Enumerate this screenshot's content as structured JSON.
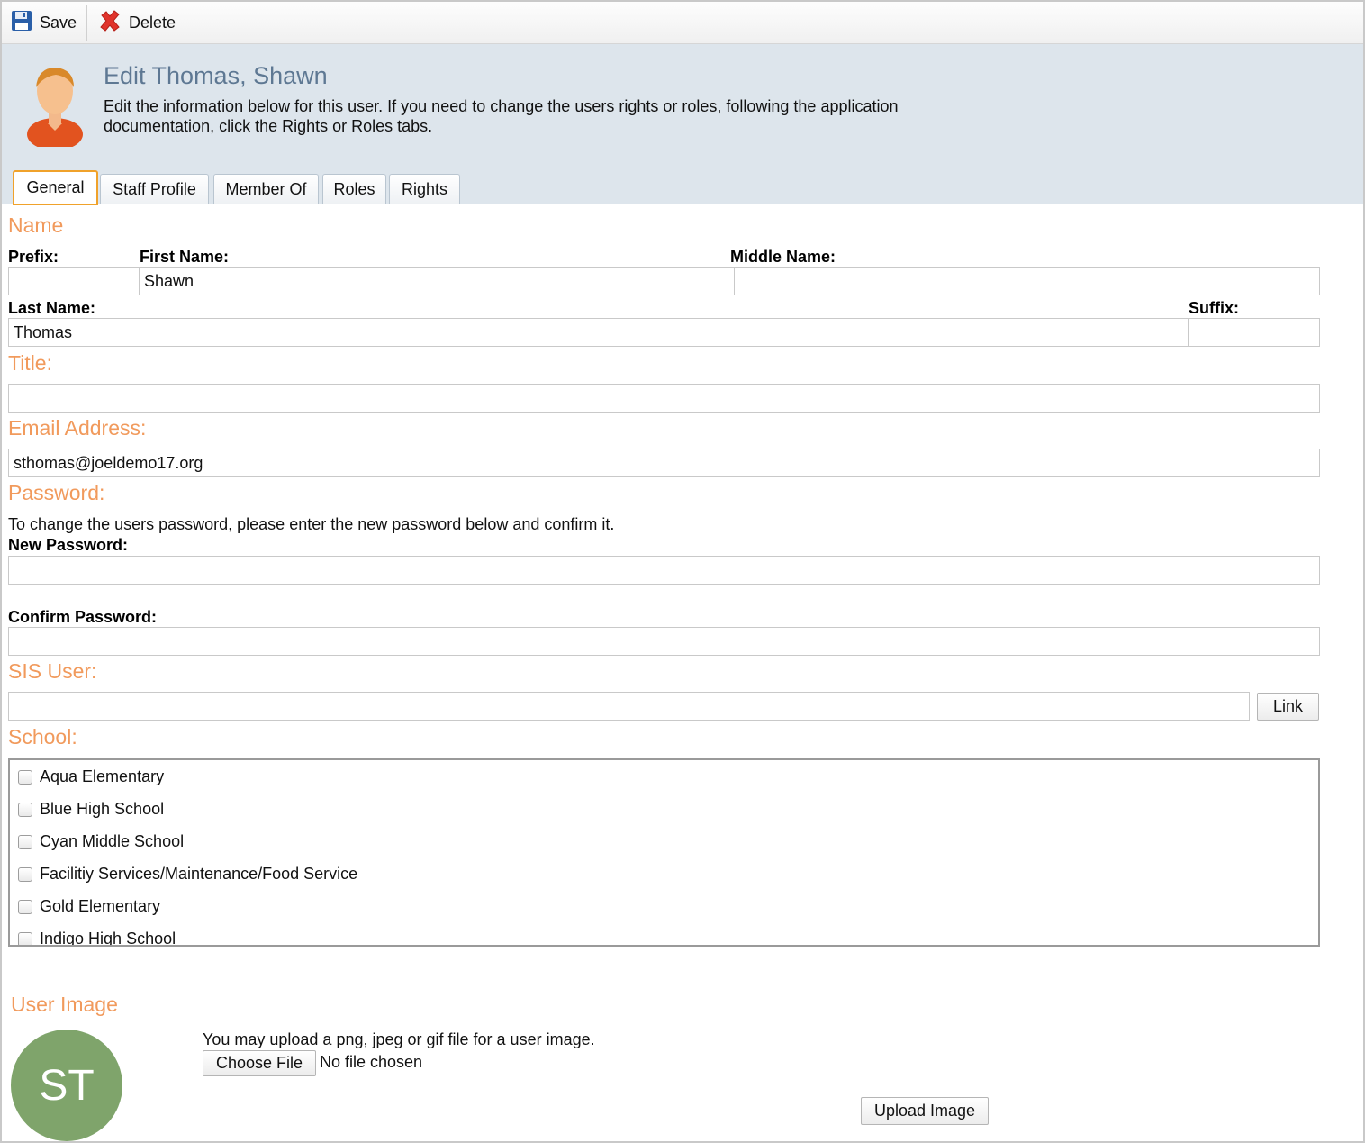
{
  "toolbar": {
    "save_label": "Save",
    "delete_label": "Delete"
  },
  "header": {
    "title": "Edit Thomas, Shawn",
    "description": "Edit the information below for this user. If you need to change the users rights or roles, following the application documentation, click the Rights or Roles tabs."
  },
  "tabs": [
    "General",
    "Staff Profile",
    "Member Of",
    "Roles",
    "Rights"
  ],
  "active_tab": "General",
  "name_section": {
    "heading": "Name",
    "prefix_label": "Prefix:",
    "prefix_value": "",
    "first_label": "First Name:",
    "first_value": "Shawn",
    "middle_label": "Middle Name:",
    "middle_value": "",
    "last_label": "Last Name:",
    "last_value": "Thomas",
    "suffix_label": "Suffix:",
    "suffix_value": ""
  },
  "title_section": {
    "heading": "Title:",
    "value": ""
  },
  "email_section": {
    "heading": "Email Address:",
    "value": "sthomas@joeldemo17.org"
  },
  "password_section": {
    "heading": "Password:",
    "instructions": "To change the users password, please enter the new password below and confirm it.",
    "new_label": "New Password:",
    "confirm_label": "Confirm Password:"
  },
  "sis_section": {
    "heading": "SIS User:",
    "value": "",
    "link_label": "Link"
  },
  "school_section": {
    "heading": "School:",
    "schools": [
      {
        "name": "Aqua Elementary",
        "checked": false
      },
      {
        "name": "Blue High School",
        "checked": false
      },
      {
        "name": "Cyan Middle School",
        "checked": false
      },
      {
        "name": "Facilitiy Services/Maintenance/Food Service",
        "checked": false
      },
      {
        "name": "Gold Elementary",
        "checked": false
      },
      {
        "name": "Indigo High School",
        "checked": false
      }
    ]
  },
  "image_section": {
    "heading": "User Image",
    "initials": "ST",
    "instructions": "You may upload a png, jpeg or gif file for a user image.",
    "choose_label": "Choose File",
    "file_status": "No file chosen",
    "upload_label": "Upload Image"
  },
  "colors": {
    "section_heading": "#f19a5c",
    "header_bg": "#dde5ec",
    "title": "#5e7893",
    "avatar_bg": "#7fa46b",
    "active_tab_border": "#f0a22b"
  }
}
